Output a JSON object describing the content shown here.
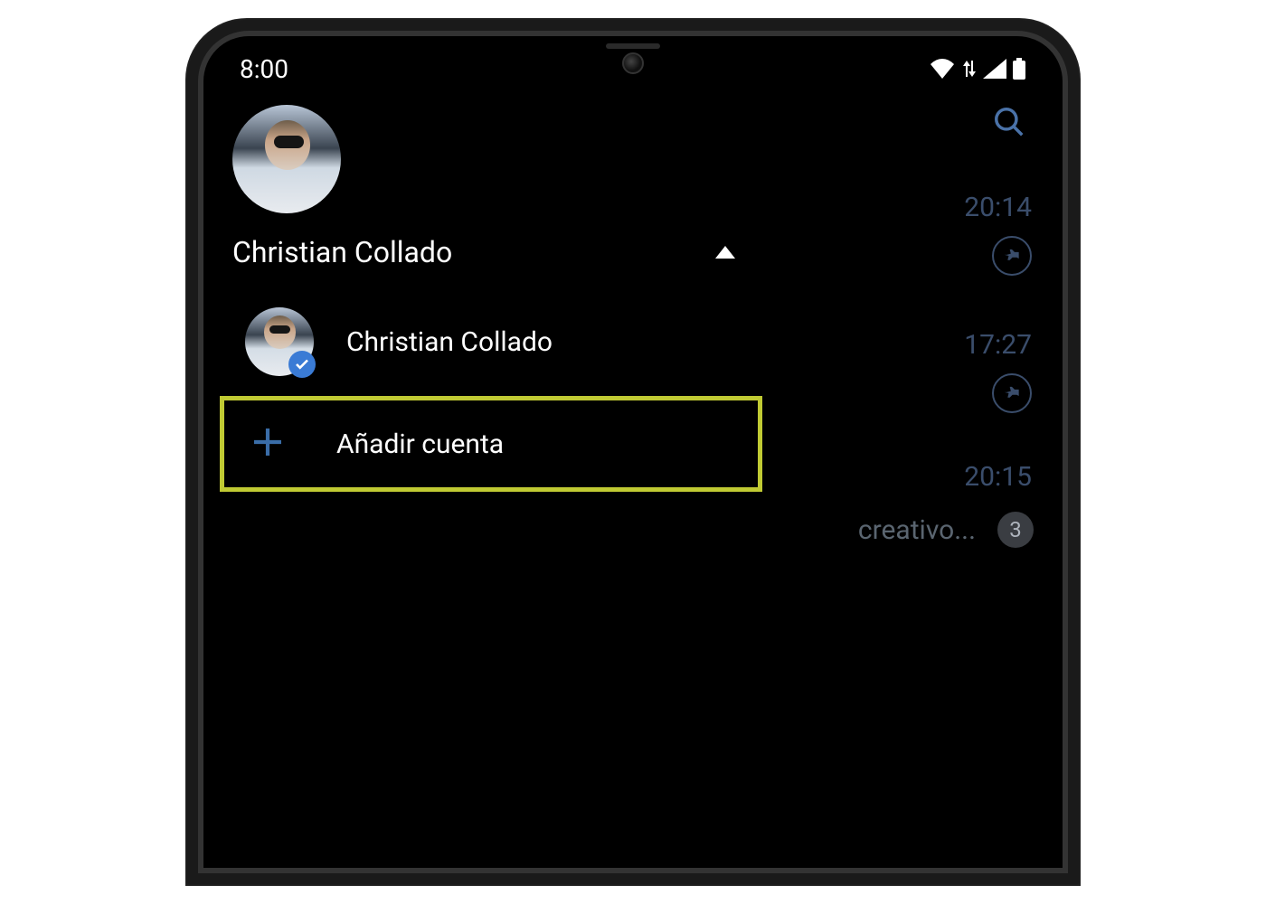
{
  "status": {
    "time": "8:00"
  },
  "profile": {
    "name": "Christian Collado"
  },
  "accounts": {
    "current": {
      "name": "Christian Collado"
    },
    "add_label": "Añadir cuenta"
  },
  "background_chats": [
    {
      "time": "20:14"
    },
    {
      "time": "17:27"
    },
    {
      "time": "20:15",
      "snippet": "creativo...",
      "count": "3"
    }
  ],
  "colors": {
    "highlight_border": "#c0ca33",
    "accent": "#3a7bd5"
  }
}
